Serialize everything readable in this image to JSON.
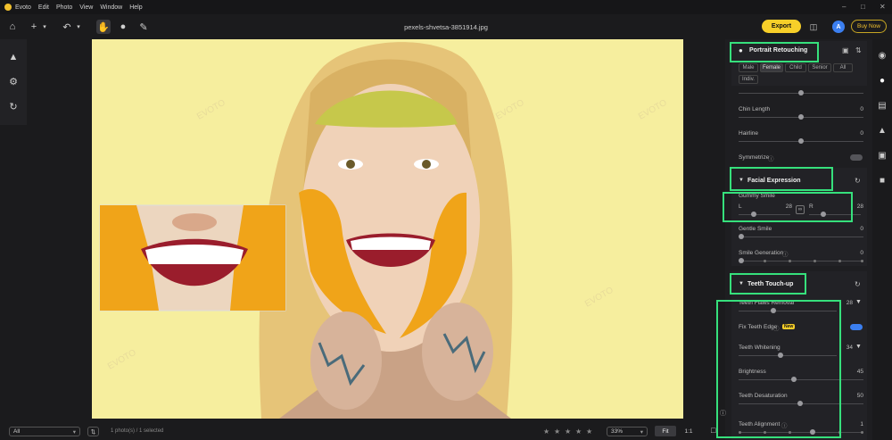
{
  "app": {
    "name": "Evoto",
    "file_name": "pexels-shvetsa-3851914.jpg"
  },
  "menu": [
    "Edit",
    "Photo",
    "View",
    "Window",
    "Help"
  ],
  "toolbar": {
    "export_label": "Export",
    "buy_label": "Buy Now",
    "avatar_letter": "A"
  },
  "bottom": {
    "filter_value": "All",
    "photo_count": "1 photo(s) / 1 selected",
    "zoom": "33%",
    "fit_label": "Fit",
    "ratio_label": "1:1",
    "rating": 0
  },
  "panel": {
    "title": "Portrait Retouching",
    "chips": [
      "Male",
      "Female",
      "Child",
      "Senior",
      "All",
      "Indiv."
    ],
    "active_chip": "Female",
    "rows_top": [
      {
        "label": "Chin Length",
        "value": "0"
      },
      {
        "label": "Hairline",
        "value": "0"
      },
      {
        "label": "Symmetrize",
        "value": "off"
      }
    ],
    "facial_expression": {
      "title": "Facial Expression",
      "gummy_smile": {
        "label": "Gummy Smile",
        "left_label": "L",
        "left_value": "28",
        "right_label": "R",
        "right_value": "28"
      },
      "gentle_smile": {
        "label": "Gentle Smile",
        "value": "0"
      },
      "smile_generation": {
        "label": "Smile Generation",
        "value": "0"
      }
    },
    "teeth": {
      "title": "Teeth Touch-up",
      "flaws": {
        "label": "Teeth Flaws Removal",
        "value": "28"
      },
      "fix_edge": {
        "label": "Fix Teeth Edge",
        "badge": "New",
        "value": "on"
      },
      "whitening": {
        "label": "Teeth Whitening",
        "value": "34"
      },
      "brightness": {
        "label": "Brightness",
        "value": "45"
      },
      "desaturation": {
        "label": "Teeth Desaturation",
        "value": "50"
      },
      "alignment": {
        "label": "Teeth Alignment",
        "value": "1"
      }
    }
  },
  "canvas": {
    "watermark": "EVOTO",
    "background": "#f6ee9e"
  },
  "colors": {
    "accent_yellow": "#f7cf29",
    "highlight_green": "#36e07c",
    "toggle_blue": "#3b7ff0"
  }
}
